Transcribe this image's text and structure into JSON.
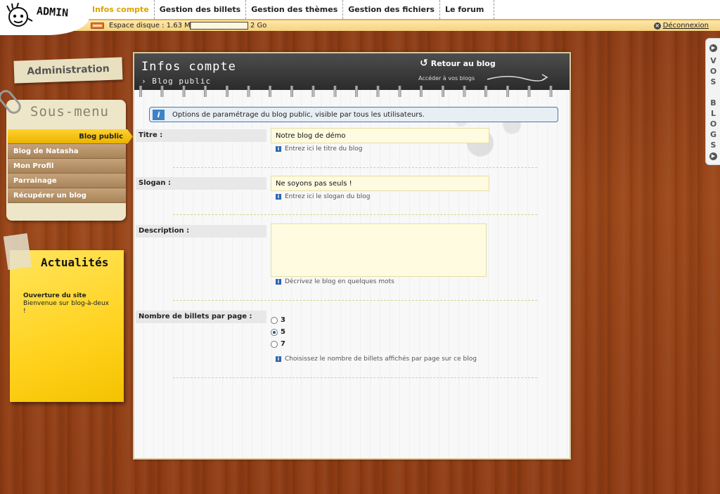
{
  "app": {
    "logo_text": "ADMIN"
  },
  "nav": {
    "items": [
      {
        "label": "Infos compte",
        "active": true
      },
      {
        "label": "Gestion des billets",
        "active": false
      },
      {
        "label": "Gestion des thèmes",
        "active": false
      },
      {
        "label": "Gestion des fichiers",
        "active": false
      },
      {
        "label": "Le forum",
        "active": false
      }
    ]
  },
  "disk": {
    "label": "Espace disque : 1.63 Mo",
    "max": "2 Go",
    "used_fraction": 0.0008
  },
  "logout": {
    "label": "Déconnexion",
    "icon": "close-icon"
  },
  "sidebar": {
    "admin_label": "Administration",
    "submenu_title": "Sous-menu",
    "items": [
      {
        "label": "Blog public",
        "active": true
      },
      {
        "label": "Blog de Natasha",
        "active": false
      },
      {
        "label": "Mon Profil",
        "active": false
      },
      {
        "label": "Parrainage",
        "active": false
      },
      {
        "label": "Récupérer un blog",
        "active": false
      }
    ]
  },
  "news": {
    "title": "Actualités",
    "item_title": "Ouverture du site",
    "item_text": "Bienvenue sur blog-à-deux !"
  },
  "side_tab": {
    "label": "VOS BLOGS"
  },
  "panel": {
    "title": "Infos compte",
    "subtitle": "› Blog public",
    "back_label": "Retour au blog",
    "access_label": "Accéder à vos blogs",
    "info_text": "Options de paramétrage du blog public, visible par tous les utilisateurs."
  },
  "form": {
    "titre": {
      "label": "Titre :",
      "value": "Notre blog de démo",
      "hint": "Entrez ici le titre du blog"
    },
    "slogan": {
      "label": "Slogan :",
      "value": "Ne soyons pas seuls !",
      "hint": "Entrez ici le slogan du blog"
    },
    "description": {
      "label": "Description :",
      "value": "",
      "hint": "Décrivez le blog en quelques mots"
    },
    "billets": {
      "label": "Nombre de billets par page :",
      "options": [
        "3",
        "5",
        "7"
      ],
      "selected": "5",
      "hint": "Choisissez le nombre de billets affichés par page sur ce blog"
    }
  },
  "colors": {
    "accent": "#d9a300",
    "submenu_active": "#f5c400",
    "wood": "#8e3b13",
    "note": "#ffd21e"
  }
}
